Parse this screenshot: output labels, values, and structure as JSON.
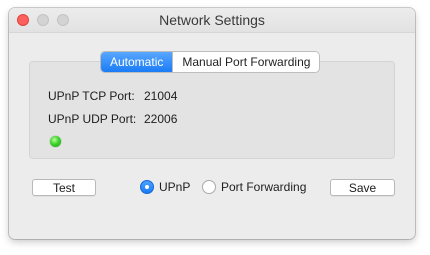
{
  "window": {
    "title": "Network Settings"
  },
  "tabs": [
    {
      "label": "Automatic",
      "selected": true
    },
    {
      "label": "Manual Port Forwarding",
      "selected": false
    }
  ],
  "ports": {
    "tcp_label": "UPnP TCP Port:",
    "tcp_value": "21004",
    "udp_label": "UPnP UDP Port:",
    "udp_value": "22006",
    "status_indicator": "green-led"
  },
  "buttons": {
    "test_label": "Test",
    "save_label": "Save"
  },
  "mode": {
    "options": [
      {
        "label": "UPnP",
        "selected": true
      },
      {
        "label": "Port Forwarding",
        "selected": false
      }
    ]
  },
  "colors": {
    "accent": "#1a7cf5",
    "close": "#fc605c",
    "status_ok": "#3fd22a"
  }
}
